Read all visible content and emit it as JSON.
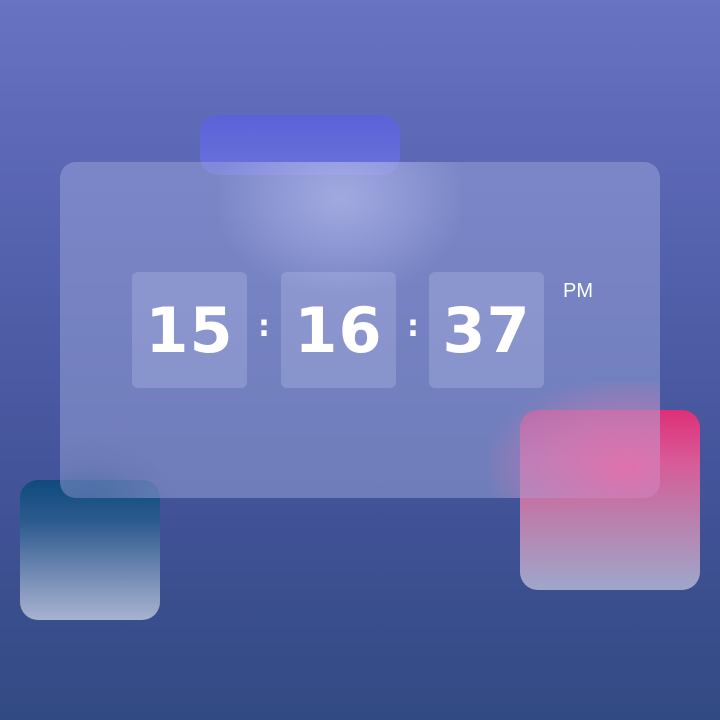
{
  "clock": {
    "hours": "15",
    "minutes": "16",
    "seconds": "37",
    "separator": ":",
    "period": "PM"
  },
  "colors": {
    "background_top": "#6873c2",
    "background_bottom": "#324a84",
    "accent_indigo": "#5a62d8",
    "accent_blue": "#0f4a7e",
    "accent_pink": "#de2f77",
    "text": "#ffffff"
  }
}
